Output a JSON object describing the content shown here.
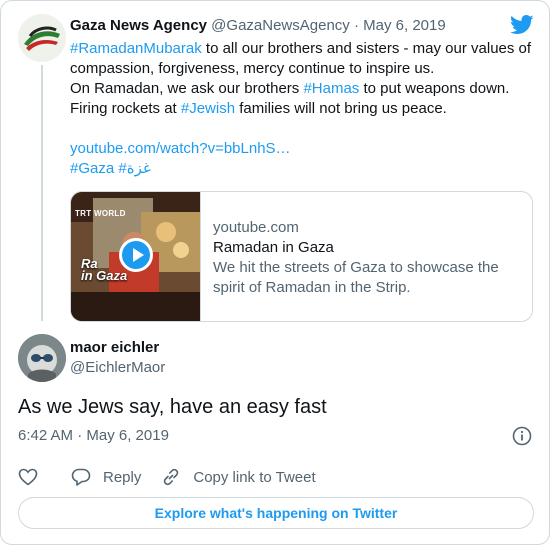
{
  "parent_tweet": {
    "name": "Gaza News Agency",
    "handle": "@GazaNewsAgency",
    "separator": "·",
    "date": "May 6, 2019",
    "line1_hashtag": "#RamadanMubarak",
    "line1_rest": " to all our brothers and sisters - may our values of",
    "line2": "compassion, forgiveness, mercy continue to inspire us.",
    "line3_pre": "On Ramadan, we ask our brothers ",
    "line3_hashtag": "#Hamas",
    "line3_post": " to put  weapons down.",
    "line4_pre": "Firing rockets at ",
    "line4_hashtag": "#Jewish",
    "line4_post": " families will not bring us peace.",
    "url": "youtube.com/watch?v=bbLnhS…",
    "hashtags_line": "#Gaza #غزة",
    "link_card": {
      "domain": "youtube.com",
      "title": "Ramadan in Gaza",
      "description": "We hit the streets of Gaza to showcase the spirit of Ramadan in the Strip.",
      "thumb_brand": "TRT WORLD",
      "thumb_title_1": "Ra",
      "thumb_title_2": "in Gaza"
    }
  },
  "tweet": {
    "name": "maor eichler",
    "handle": "@EichlerMaor",
    "text": "As we Jews say, have an easy fast",
    "timestamp": "6:42 AM · May 6, 2019"
  },
  "actions": {
    "reply_label": "Reply",
    "copy_label": "Copy link to Tweet"
  },
  "explore_label": "Explore what's happening on Twitter",
  "icons": {
    "bird": "twitter-bird-icon",
    "info": "info-icon",
    "like": "heart-icon",
    "reply": "reply-icon",
    "copy": "link-icon",
    "play": "play-icon"
  },
  "colors": {
    "accent": "#1d9bf0",
    "text": "#0f1419",
    "secondary": "#536471",
    "border": "#cfd9de"
  }
}
